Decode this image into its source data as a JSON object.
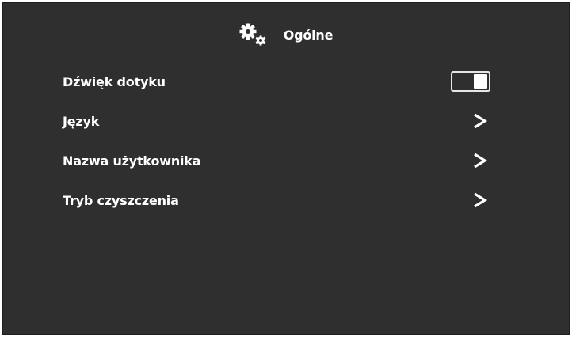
{
  "header": {
    "title": "Ogólne",
    "icon": "gears-icon"
  },
  "settings": {
    "items": [
      {
        "label": "Dźwięk dotyku",
        "control": "toggle",
        "value": true
      },
      {
        "label": "Język",
        "control": "chevron"
      },
      {
        "label": "Nazwa użytkownika",
        "control": "chevron"
      },
      {
        "label": "Tryb czyszczenia",
        "control": "chevron"
      }
    ]
  },
  "colors": {
    "background": "#2f2f2f",
    "text": "#ffffff"
  }
}
